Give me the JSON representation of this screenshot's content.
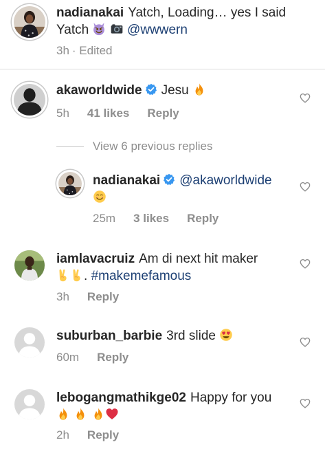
{
  "comments": [
    {
      "username": "nadianakai",
      "text": "Yatch, Loading… yes I said Yatch",
      "mention": "@wwwern",
      "time": "3h",
      "edited": "· Edited"
    },
    {
      "username": "akaworldwide",
      "text": "Jesu",
      "time": "5h",
      "likes": "41 likes",
      "reply": "Reply"
    },
    {
      "username": "nadianakai",
      "mention": "@akaworldwide",
      "time": "25m",
      "likes": "3 likes",
      "reply": "Reply"
    },
    {
      "username": "iamlavacruiz",
      "text": "Am di next hit maker",
      "text2": ".",
      "hashtag": "#makemefamous",
      "time": "3h",
      "reply": "Reply"
    },
    {
      "username": "suburban_barbie",
      "text": "3rd slide",
      "time": "60m",
      "reply": "Reply"
    },
    {
      "username": "lebogangmathikge02",
      "text": "Happy for you",
      "time": "2h",
      "reply": "Reply"
    }
  ],
  "view_previous_replies": "View 6 previous replies",
  "icons": {
    "heart": "heart-outline-icon",
    "verified": "verified-badge-icon",
    "verified_color": "#3897f0",
    "link_color": "#1c3f73"
  }
}
